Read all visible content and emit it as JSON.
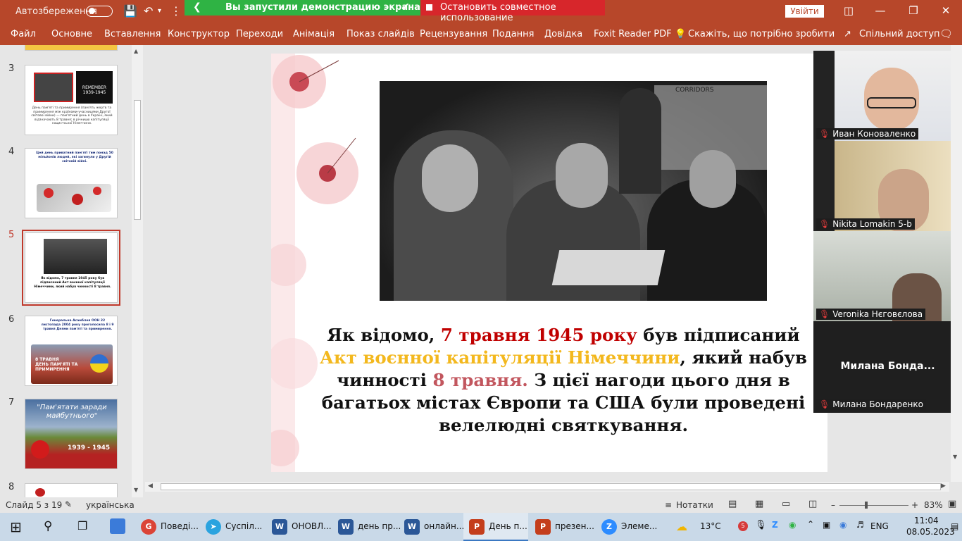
{
  "titlebar": {
    "autosave": "Автозбереження",
    "signin": "Увійти"
  },
  "share": {
    "running": "Вы запустили демонстрацию экрана",
    "stop": "Остановить совместное использование"
  },
  "ribbon": {
    "tabs": [
      "Файл",
      "Основне",
      "Вставлення",
      "Конструктор",
      "Переходи",
      "Анімація",
      "Показ слайдів",
      "Рецензування",
      "Подання",
      "Довідка",
      "Foxit Reader PDF"
    ],
    "tell": "Скажіть, що потрібно зробити",
    "share": "Спільний доступ"
  },
  "thumbs": {
    "nums": [
      "3",
      "4",
      "5",
      "6",
      "7",
      "8"
    ],
    "s3": {
      "poster": "REMEMBER 1939-1945",
      "text": "День пам'яті та примирення (пам'ять жертв та примирення між країнами-учасницями Другої світової війни) — пам'ятний день в Україні, який відзначають 8 травня; в річницю капітуляції нацистської Німеччини."
    },
    "s4": {
      "text": "Цей день приватний пам'яті тим понад 50 мільйонів людей, які загинули у Другій світовій війні."
    },
    "s5": {
      "text": "Як відомо, 7 травня 1945 року був підписаний Акт воєнної капітуляції Німеччини, який набув чинності 8 травня."
    },
    "s6": {
      "text": "Генеральна Асамблея ООН 22 листопада 2004 року проголосила 8 і 9 травня Днями пам'яті та примирення.",
      "banner1": "8 ТРАВНЯ",
      "banner2": "ДЕНЬ ПАМ'ЯТІ ТА ПРИМИРЕННЯ"
    },
    "s7": {
      "title": "\"Пам'ятати заради майбутнього\"",
      "years": "1939 - 1945"
    }
  },
  "slide": {
    "t1": "Як відомо, ",
    "t2": "7 травня 1945 року",
    "t3": " був підписаний ",
    "t4": "Акт воєнної капітуляції Німеччини",
    "t5": ", який набув чинності ",
    "t6": "8 травня.",
    "t7": " З цієї нагоди цього дня в багатьох містах Європи та США були проведені велелюдні святкування.",
    "photo_sign": "CORRIDORS"
  },
  "video": {
    "participants": [
      "Иван Коноваленко",
      "Nikita Lomakin 5-b",
      "Veronіka Нєговєлова",
      "Милана Бондаренко"
    ],
    "tile_label": "Милана  Бонда..."
  },
  "status": {
    "slide": "Слайд 5 з 19",
    "lang": "українська",
    "notes": "Нотатки",
    "zoom": "83%"
  },
  "taskbar": {
    "apps": [
      "Поведі...",
      "Суспіл...",
      "ОНОВЛ...",
      "день пр...",
      "онлайн...",
      "День п...",
      "презен...",
      "Элеме..."
    ],
    "badge": "5",
    "temp": "13°C",
    "kbd": "ENG",
    "time": "11:04",
    "date": "08.05.2023"
  },
  "colors": {
    "ppt": "#b7472a",
    "accent_red": "#c00000",
    "accent_gold": "#f3b81e"
  }
}
